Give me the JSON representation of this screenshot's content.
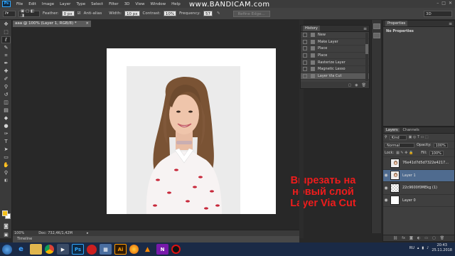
{
  "watermark": "www.BANDICAM.com",
  "menu": [
    "File",
    "Edit",
    "Image",
    "Layer",
    "Type",
    "Select",
    "Filter",
    "3D",
    "View",
    "Window",
    "Help"
  ],
  "ps_logo": "Ps",
  "options": {
    "feather_label": "Feather:",
    "feather_value": "0 px",
    "antialias_label": "Anti-alias",
    "width_label": "Width:",
    "width_value": "10 px",
    "contrast_label": "Contrast:",
    "contrast_value": "10%",
    "frequency_label": "Frequency:",
    "frequency_value": "57",
    "refine_edge": "Refine Edge...",
    "workspace": "3D"
  },
  "document": {
    "tab_title": "aaa @ 100% (Layer 1, RGB/8) *",
    "zoom": "100%",
    "doc_info": "Doc: 732,4K/1,42M",
    "timeline": "Timeline"
  },
  "history": {
    "title": "History",
    "items": [
      "New",
      "Make Layer",
      "Place",
      "Place",
      "Rasterize Layer",
      "Magnetic Lasso",
      "Layer Via Cut"
    ],
    "active_index": 6
  },
  "properties": {
    "title": "Properties",
    "empty_text": "No Properties"
  },
  "layers_panel": {
    "tabs": [
      "Layers",
      "Channels"
    ],
    "kind_label": "Kind",
    "blend_mode": "Normal",
    "opacity_label": "Opacity:",
    "opacity_value": "100%",
    "lock_label": "Lock:",
    "fill_label": "Fill:",
    "fill_value": "100%",
    "layers": [
      {
        "name": "76e41d7d5d7322e4217...",
        "visible": false,
        "active": false,
        "thumb": "portrait"
      },
      {
        "name": "Layer 1",
        "visible": true,
        "active": true,
        "thumb": "portrait"
      },
      {
        "name": "22c9600f0MEkg (1)",
        "visible": true,
        "active": false,
        "thumb": "checker"
      },
      {
        "name": "Layer 0",
        "visible": true,
        "active": false,
        "thumb": "white"
      }
    ]
  },
  "overlay_text": [
    "Вырезать на",
    "новый слой",
    "Layer Via Cut"
  ],
  "taskbar": {
    "apps": [
      "start",
      "ie",
      "explorer",
      "chrome",
      "media",
      "ps",
      "opera",
      "calc",
      "ai",
      "firefox",
      "vlc",
      "onenote",
      "record"
    ],
    "lang": "RU",
    "time": "20:43",
    "date": "25.11.2018"
  },
  "colors": {
    "foreground": "#f3c01a",
    "background": "#ffffff",
    "overlay_text": "#ee1c1c"
  }
}
